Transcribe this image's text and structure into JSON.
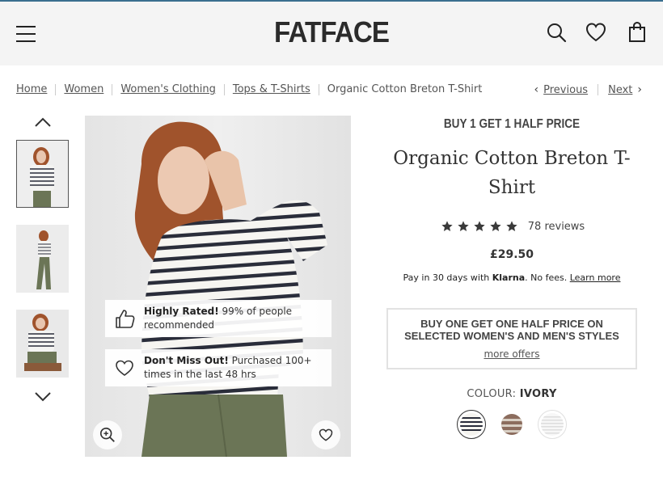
{
  "header": {
    "logo": "FATFACE",
    "icons": [
      "menu-icon",
      "search-icon",
      "heart-icon",
      "bag-icon"
    ]
  },
  "breadcrumb": {
    "items": [
      "Home",
      "Women",
      "Women's Clothing",
      "Tops & T-Shirts"
    ],
    "current": "Organic Cotton Breton T-Shirt",
    "previous": "Previous",
    "next": "Next"
  },
  "gallery": {
    "badges": {
      "rated": {
        "title": "Highly Rated!",
        "text": "99% of people recommended"
      },
      "miss": {
        "title": "Don't Miss Out!",
        "text": "Purchased 100+ times in the last 48 hrs"
      }
    }
  },
  "product": {
    "promo": "BUY 1 GET 1 HALF PRICE",
    "title": "Organic Cotton Breton T-Shirt",
    "rating": 5,
    "reviews": "78 reviews",
    "price": "£29.50",
    "klarna": {
      "prefix": "Pay in 30 days with",
      "brand": "Klarna",
      "suffix": ". No fees.",
      "link": "Learn more"
    },
    "offer": {
      "text": "BUY ONE GET ONE HALF PRICE ON SELECTED WOMEN'S AND MEN'S STYLES",
      "link": "more offers"
    },
    "colour": {
      "label": "COLOUR:",
      "value": "IVORY",
      "options": [
        "ivory-stripe",
        "brown-stripe",
        "white-stripe"
      ]
    }
  },
  "colors": {
    "header_bg": "#f4f4f4",
    "top_border": "#3a6f8f",
    "stripe_navy": "#2a2d3a",
    "trouser_green": "#6b7556",
    "hair": "#a0532c"
  }
}
